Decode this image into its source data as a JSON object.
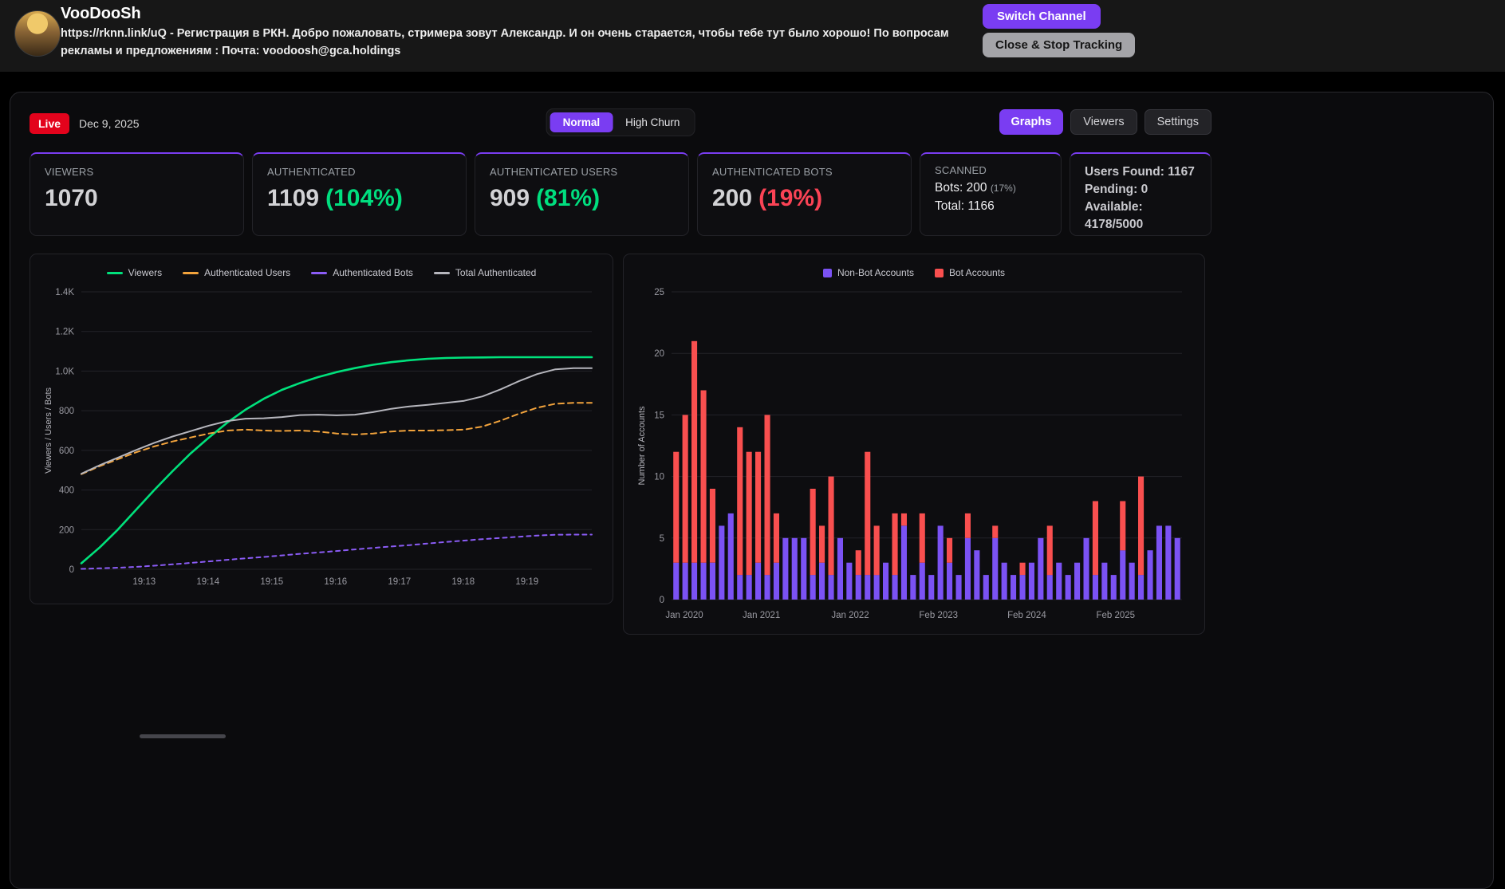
{
  "colors": {
    "accent_purple": "#7a3df2",
    "live_red": "#e3031c",
    "positive_green": "#00df7f",
    "negative_red": "#fb4355",
    "viewers_line": "#00e17c",
    "auth_users_line": "#f2a33c",
    "auth_bots_line": "#8b5cf6",
    "total_auth_line": "#b6b6bd",
    "nonbot_bar": "#7b52f4",
    "bot_bar": "#f94f4f"
  },
  "header": {
    "channel_name": "VooDooSh",
    "description": "https://rknn.link/uQ - Регистрация в РКН. Добро пожаловать, стримера зовут Александр. И он очень старается, чтобы тебе тут было хорошо! По вопросам рекламы и предложениям : Почта: voodoosh@gca.holdings",
    "buttons": {
      "switch_channel": "Switch Channel",
      "close_stop_tracking": "Close & Stop Tracking"
    }
  },
  "toolbar": {
    "live_badge": "Live",
    "date": "Dec 9, 2025",
    "mode_toggle": {
      "normal": "Normal",
      "high_churn": "High Churn",
      "selected": "Normal"
    },
    "view_tabs": {
      "graphs": "Graphs",
      "viewers": "Viewers",
      "settings": "Settings",
      "selected": "Graphs"
    }
  },
  "stats": {
    "viewers": {
      "label": "VIEWERS",
      "value": "1070"
    },
    "authenticated": {
      "label": "AUTHENTICATED",
      "value": "1109",
      "percent": "(104%)"
    },
    "authenticated_users": {
      "label": "AUTHENTICATED USERS",
      "value": "909",
      "percent": "(81%)"
    },
    "authenticated_bots": {
      "label": "AUTHENTICATED BOTS",
      "value": "200",
      "percent": "(19%)"
    },
    "scanned": {
      "label": "SCANNED",
      "bots_text": "Bots: 200",
      "bots_percent": "(17%)",
      "total_text": "Total: 1166"
    },
    "capacity": {
      "users_found": "Users Found: 1167",
      "pending": "Pending: 0",
      "available_label": "Available:",
      "available_value": "4178/5000"
    }
  },
  "chart_data": [
    {
      "type": "line",
      "title": "",
      "ylabel": "Viewers / Users / Bots",
      "ylim": [
        0,
        1400
      ],
      "yticks": [
        0,
        200,
        400,
        600,
        800,
        1000,
        1200,
        1400
      ],
      "ytick_labels": [
        "0",
        "200",
        "400",
        "600",
        "800",
        "1.0K",
        "1.2K",
        "1.4K"
      ],
      "x_ticks": [
        "19:13",
        "19:14",
        "19:15",
        "19:16",
        "19:17",
        "19:18",
        "19:19"
      ],
      "x_tick_fracs": [
        0.123,
        0.248,
        0.373,
        0.498,
        0.623,
        0.748,
        0.873
      ],
      "grid": true,
      "legend_position": "top",
      "series": [
        {
          "name": "Viewers",
          "color": "#00e17c",
          "dash": null,
          "width": 2.6,
          "values": [
            30,
            110,
            200,
            300,
            400,
            495,
            585,
            665,
            740,
            805,
            860,
            905,
            940,
            970,
            995,
            1015,
            1032,
            1045,
            1055,
            1062,
            1066,
            1068,
            1069,
            1070,
            1070,
            1070,
            1070,
            1070,
            1070
          ]
        },
        {
          "name": "Authenticated Users",
          "color": "#f2a33c",
          "dash": "7 5",
          "width": 2,
          "values": [
            480,
            520,
            555,
            590,
            620,
            645,
            665,
            685,
            700,
            705,
            700,
            698,
            700,
            695,
            685,
            680,
            685,
            695,
            700,
            700,
            702,
            705,
            720,
            750,
            785,
            815,
            835,
            840,
            840
          ]
        },
        {
          "name": "Authenticated Bots",
          "color": "#8b5cf6",
          "dash": "5 5",
          "width": 2,
          "values": [
            2,
            5,
            8,
            12,
            18,
            25,
            32,
            40,
            48,
            55,
            62,
            70,
            78,
            85,
            92,
            100,
            108,
            115,
            122,
            130,
            138,
            145,
            152,
            158,
            164,
            170,
            174,
            175,
            175
          ]
        },
        {
          "name": "Total Authenticated",
          "color": "#b6b6bd",
          "dash": null,
          "width": 2,
          "values": [
            482,
            525,
            563,
            602,
            638,
            670,
            697,
            725,
            748,
            760,
            762,
            768,
            778,
            780,
            777,
            780,
            793,
            810,
            822,
            830,
            840,
            850,
            872,
            908,
            949,
            985,
            1009,
            1015,
            1015
          ]
        }
      ]
    },
    {
      "type": "bar",
      "stacked": true,
      "title": "",
      "ylabel": "Number of Accounts",
      "ylim": [
        0,
        25
      ],
      "yticks": [
        0,
        5,
        10,
        15,
        20,
        25
      ],
      "ytick_labels": [
        "0",
        "5",
        "10",
        "15",
        "20",
        "25"
      ],
      "x_ticks": [
        "Jan 2020",
        "Jan 2021",
        "Jan 2022",
        "Feb 2023",
        "Feb 2024",
        "Feb 2025"
      ],
      "x_tick_fracs": [
        0.025,
        0.176,
        0.35,
        0.523,
        0.696,
        0.87
      ],
      "grid": true,
      "legend_position": "top",
      "series": [
        {
          "name": "Non-Bot Accounts",
          "color": "#7b52f4",
          "values": [
            3,
            3,
            3,
            3,
            3,
            6,
            7,
            2,
            2,
            3,
            2,
            3,
            5,
            5,
            5,
            2,
            3,
            2,
            5,
            3,
            2,
            2,
            2,
            3,
            2,
            6,
            2,
            3,
            2,
            6,
            3,
            2,
            5,
            4,
            2,
            5,
            3,
            2,
            2,
            3,
            5,
            2,
            3,
            2,
            3,
            5,
            2,
            3,
            2,
            4,
            3,
            2,
            4,
            6,
            6,
            5
          ]
        },
        {
          "name": "Bot Accounts",
          "color": "#f94f4f",
          "values": [
            9,
            12,
            18,
            14,
            6,
            0,
            0,
            12,
            10,
            9,
            13,
            4,
            0,
            0,
            0,
            7,
            3,
            8,
            0,
            0,
            2,
            10,
            4,
            0,
            5,
            1,
            0,
            4,
            0,
            0,
            2,
            0,
            2,
            0,
            0,
            1,
            0,
            0,
            1,
            0,
            0,
            4,
            0,
            0,
            0,
            0,
            6,
            0,
            0,
            4,
            0,
            8,
            0,
            0,
            0,
            0
          ]
        }
      ]
    }
  ]
}
